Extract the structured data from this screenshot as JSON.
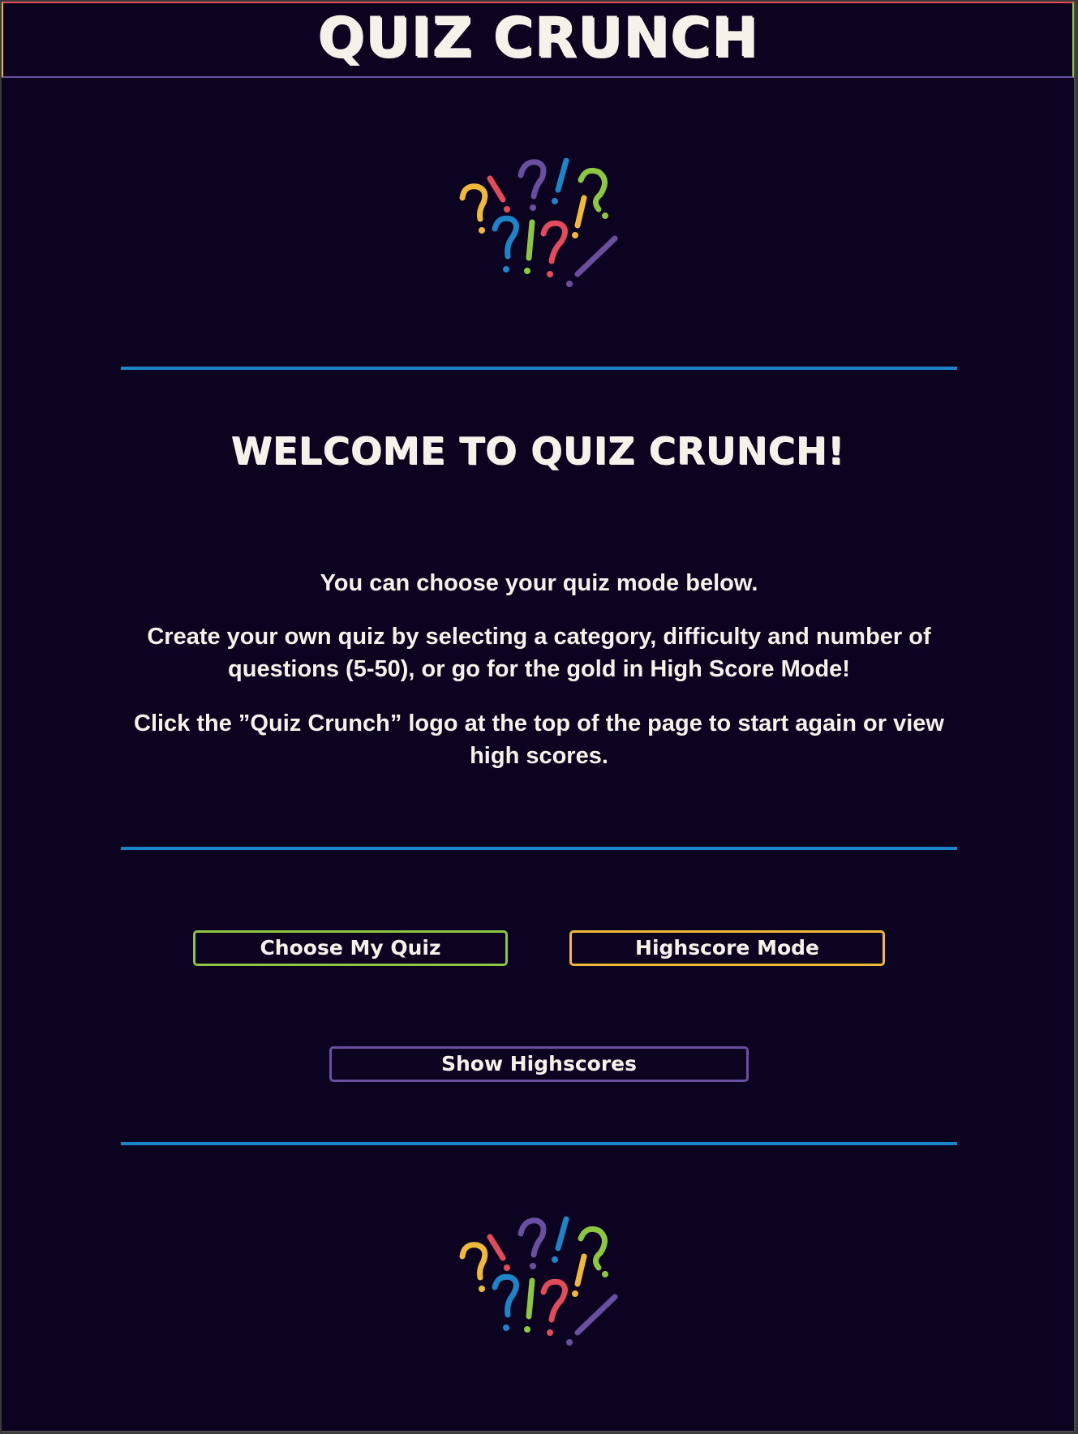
{
  "header": {
    "title": "QUIZ CRUNCH"
  },
  "logo": {
    "icon": "question-exclamation-marks-icon",
    "colors": [
      "#f0b93a",
      "#e24b5a",
      "#6a4fa0",
      "#1e84c8",
      "#8dc63f"
    ]
  },
  "main": {
    "welcome": "WELCOME TO QUIZ CRUNCH!",
    "paragraphs": [
      "You can choose your quiz mode below.",
      "Create your own quiz by selecting a category, difficulty and number of questions (5-50), or go for the gold in High Score Mode!",
      "Click the ”Quiz Crunch” logo at the top of the page to start again or view high scores."
    ]
  },
  "buttons": {
    "choose_quiz": "Choose My Quiz",
    "highscore_mode": "Highscore Mode",
    "show_highscores": "Show Highscores"
  },
  "colors": {
    "background": "#0b0320",
    "divider": "#1e84c8",
    "text": "#f6f2ea",
    "green": "#8dc63f",
    "yellow": "#f0b93a",
    "purple": "#6a4fa0",
    "red": "#e24b5a"
  }
}
